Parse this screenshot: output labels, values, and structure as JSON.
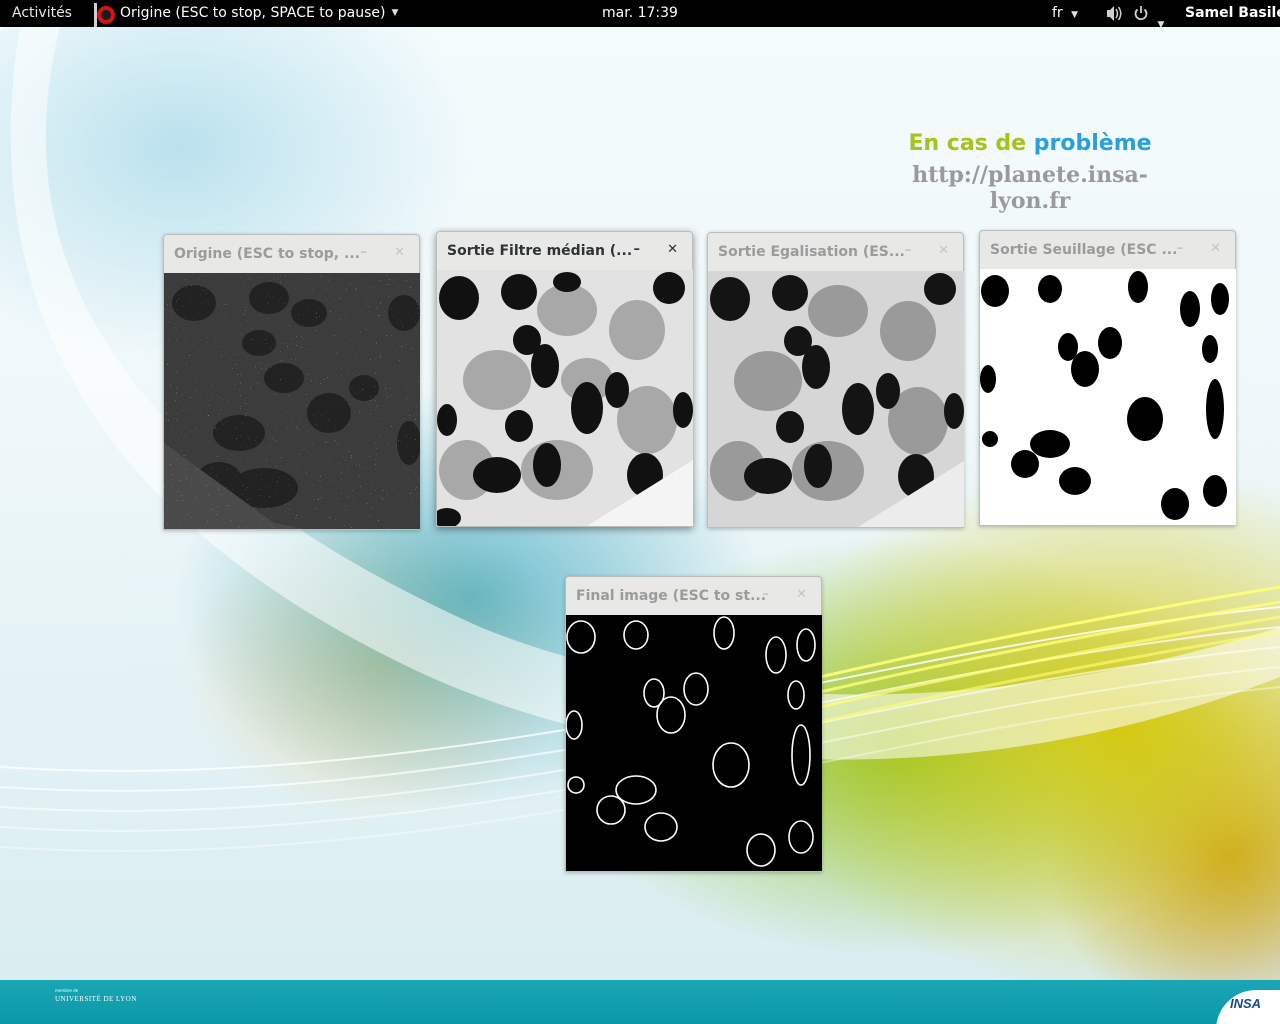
{
  "topbar": {
    "activities": "Activités",
    "app_title": "Origine (ESC to stop, SPACE to pause)",
    "clock": "mar. 17:39",
    "lang": "fr",
    "user": "Samel Basile"
  },
  "banner": {
    "line1_part1": "En cas de",
    "line1_part2": "problème",
    "url": "http://planete.insa-lyon.fr"
  },
  "windows": {
    "origine": "Origine (ESC to stop, ...",
    "median": "Sortie Filtre médian (...",
    "egalisation": "Sortie Egalisation (ES...",
    "seuillage": "Sortie Seuillage (ESC ...",
    "final": "Final image (ESC to st..."
  },
  "window_buttons": {
    "minimize": "–",
    "close": "✕"
  },
  "bottom": {
    "univ_small": "membre de",
    "univ": "UNIVERSITÉ DE LYON",
    "insa": "INSA"
  },
  "colors": {
    "banner_green": "#a6c21c",
    "banner_blue": "#2aa0d8",
    "bottom_band": "#0b98a8"
  },
  "icons": {
    "app": "camera-record-icon",
    "volume": "volume-icon",
    "power": "power-icon"
  }
}
